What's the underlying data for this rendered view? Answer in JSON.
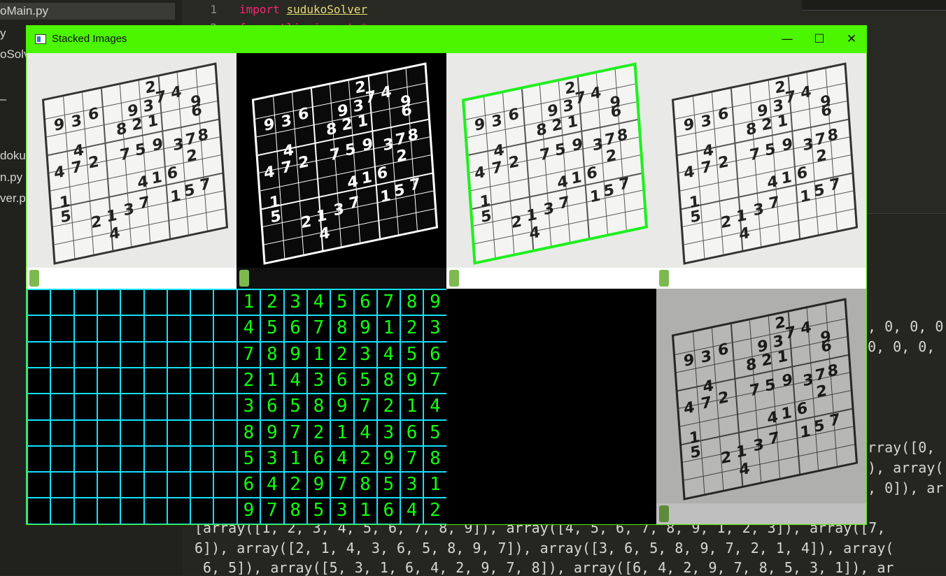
{
  "sidebar": {
    "items": [
      "oMain.py",
      "y",
      "oSolv",
      "–",
      "doku",
      "n.py",
      "ver.py"
    ]
  },
  "editor": {
    "line1_num": "1",
    "line2_num": "2",
    "import_kw": "import",
    "import_module": "sudukoSolver",
    "line2_partial": "from utlis import *"
  },
  "console": {
    "lines": [
      ", 0, 0, 0,",
      "0, 0, 0,",
      "rray([0,",
      "), array(",
      ", 0]), ar",
      "[array([1, 2, 3, 4, 5, 6, 7, 8, 9]), array([4, 5, 6, 7, 8, 9, 1, 2, 3]), array([7,",
      "6]), array([2, 1, 4, 3, 6, 5, 8, 9, 7]), array([3, 6, 5, 8, 9, 7, 2, 1, 4]), array(",
      " 6, 5]), array([5, 3, 1, 6, 4, 2, 9, 7, 8]), array([6, 4, 2, 9, 7, 8, 5, 3, 1]), ar"
    ]
  },
  "window": {
    "title": "Stacked Images",
    "minimize_glyph": "—",
    "maximize_glyph": "☐",
    "close_glyph": "✕",
    "accent": "#4cf500"
  },
  "photo": {
    "numbers": [
      {
        "t": "9",
        "r": 0.08,
        "c": 0.05
      },
      {
        "t": "3",
        "r": 0.08,
        "c": 0.16
      },
      {
        "t": "6",
        "r": 0.06,
        "c": 0.27
      },
      {
        "t": "2",
        "r": -0.04,
        "c": 0.64
      },
      {
        "t": "9",
        "r": 0.09,
        "c": 0.52
      },
      {
        "t": "3",
        "r": 0.08,
        "c": 0.62
      },
      {
        "t": "7",
        "r": 0.04,
        "c": 0.7
      },
      {
        "t": "4",
        "r": 0.03,
        "c": 0.8
      },
      {
        "t": "9",
        "r": 0.12,
        "c": 0.92
      },
      {
        "t": "8",
        "r": 0.2,
        "c": 0.44
      },
      {
        "t": "2",
        "r": 0.19,
        "c": 0.54
      },
      {
        "t": "1",
        "r": 0.19,
        "c": 0.64
      },
      {
        "t": "6",
        "r": 0.18,
        "c": 0.92
      },
      {
        "t": "4",
        "r": 0.28,
        "c": 0.16
      },
      {
        "t": "4",
        "r": 0.4,
        "c": 0.03
      },
      {
        "t": "7",
        "r": 0.39,
        "c": 0.14
      },
      {
        "t": "2",
        "r": 0.38,
        "c": 0.25
      },
      {
        "t": "7",
        "r": 0.37,
        "c": 0.45
      },
      {
        "t": "5",
        "r": 0.36,
        "c": 0.55
      },
      {
        "t": "9",
        "r": 0.35,
        "c": 0.66
      },
      {
        "t": "3",
        "r": 0.38,
        "c": 0.79
      },
      {
        "t": "7",
        "r": 0.36,
        "c": 0.87
      },
      {
        "t": "8",
        "r": 0.35,
        "c": 0.95
      },
      {
        "t": "2",
        "r": 0.47,
        "c": 0.87
      },
      {
        "t": "1",
        "r": 0.6,
        "c": 0.05
      },
      {
        "t": "4",
        "r": 0.58,
        "c": 0.55
      },
      {
        "t": "1",
        "r": 0.57,
        "c": 0.64
      },
      {
        "t": "6",
        "r": 0.56,
        "c": 0.74
      },
      {
        "t": "5",
        "r": 0.7,
        "c": 0.05
      },
      {
        "t": "2",
        "r": 0.78,
        "c": 0.24
      },
      {
        "t": "1",
        "r": 0.76,
        "c": 0.34
      },
      {
        "t": "3",
        "r": 0.74,
        "c": 0.45
      },
      {
        "t": "7",
        "r": 0.72,
        "c": 0.55
      },
      {
        "t": "1",
        "r": 0.72,
        "c": 0.75
      },
      {
        "t": "5",
        "r": 0.7,
        "c": 0.84
      },
      {
        "t": "7",
        "r": 0.68,
        "c": 0.94
      },
      {
        "t": "4",
        "r": 0.88,
        "c": 0.35
      }
    ]
  },
  "solution": [
    [
      "1",
      "2",
      "3",
      "4",
      "5",
      "6",
      "7",
      "8",
      "9"
    ],
    [
      "4",
      "5",
      "6",
      "7",
      "8",
      "9",
      "1",
      "2",
      "3"
    ],
    [
      "7",
      "8",
      "9",
      "1",
      "2",
      "3",
      "4",
      "5",
      "6"
    ],
    [
      "2",
      "1",
      "4",
      "3",
      "6",
      "5",
      "8",
      "9",
      "7"
    ],
    [
      "3",
      "6",
      "5",
      "8",
      "9",
      "7",
      "2",
      "1",
      "4"
    ],
    [
      "8",
      "9",
      "7",
      "2",
      "1",
      "4",
      "3",
      "6",
      "5"
    ],
    [
      "5",
      "3",
      "1",
      "6",
      "4",
      "2",
      "9",
      "7",
      "8"
    ],
    [
      "6",
      "4",
      "2",
      "9",
      "7",
      "8",
      "5",
      "3",
      "1"
    ],
    [
      "9",
      "7",
      "8",
      "5",
      "3",
      "1",
      "6",
      "4",
      "2"
    ]
  ]
}
